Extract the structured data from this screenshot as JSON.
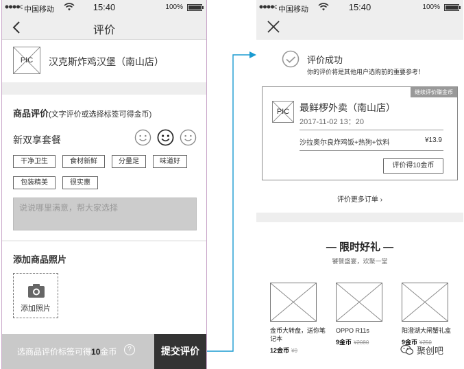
{
  "status_bar": {
    "carrier": "中国移动",
    "time": "15:40",
    "battery": "100%"
  },
  "review_screen": {
    "title": "评价",
    "shop": {
      "pic_label": "PIC",
      "name": "汉克斯炸鸡汉堡（南山店）"
    },
    "product_review": {
      "heading": "商品评价",
      "note": "(文字评价或选择标签可得金币)",
      "dish": "新双享套餐",
      "ratings": [
        "smile-icon",
        "happy-icon",
        "smile-icon"
      ],
      "tags": [
        "干净卫生",
        "食材新鲜",
        "分量足",
        "味道好",
        "包装精美",
        "很实惠"
      ],
      "comment_placeholder": "说说哪里满意，帮大家选择"
    },
    "photos": {
      "heading": "添加商品照片",
      "add_label": "添加照片"
    },
    "bottom_bar": {
      "hint_prefix": "选商品评价标签可得",
      "hint_coins": "10",
      "hint_suffix": "金币",
      "help": "?",
      "submit": "提交评价"
    }
  },
  "success_screen": {
    "success_title": "评价成功",
    "success_sub": "你的评价将是其他用户选购前的重要参考！",
    "order": {
      "badge": "继续评价赚金币",
      "pic_label": "PIC",
      "shop": "最鲜椤外卖（南山店）",
      "time": "2017-11-02 13：20",
      "item": "沙拉奥尔良炸鸡饭+热狗+饮料",
      "price": "¥13.9",
      "review_button": "评价得10金币"
    },
    "more_orders": "评价更多订单",
    "more_orders_arrow": "›",
    "gift_section": {
      "title": "— 限时好礼 —",
      "subtitle": "饕餮盛宴，欢聚一堂",
      "items": [
        {
          "name": "金币大转盘，送你笔记本",
          "coins": "12金币",
          "old": "¥0"
        },
        {
          "name": "OPPO R11s",
          "coins": "9金币",
          "old": "¥2080"
        },
        {
          "name": "阳澄湖大闸蟹礼盒",
          "coins": "9金币",
          "old": "¥250"
        }
      ]
    }
  },
  "watermark": "聚创吧",
  "colors": {
    "connector": "#1a9bd1",
    "nav_bg": "#eeeeee",
    "submit_bg": "#333333",
    "bottom_bar_bg": "#c9c9c9",
    "comment_bg": "#cccccc"
  }
}
